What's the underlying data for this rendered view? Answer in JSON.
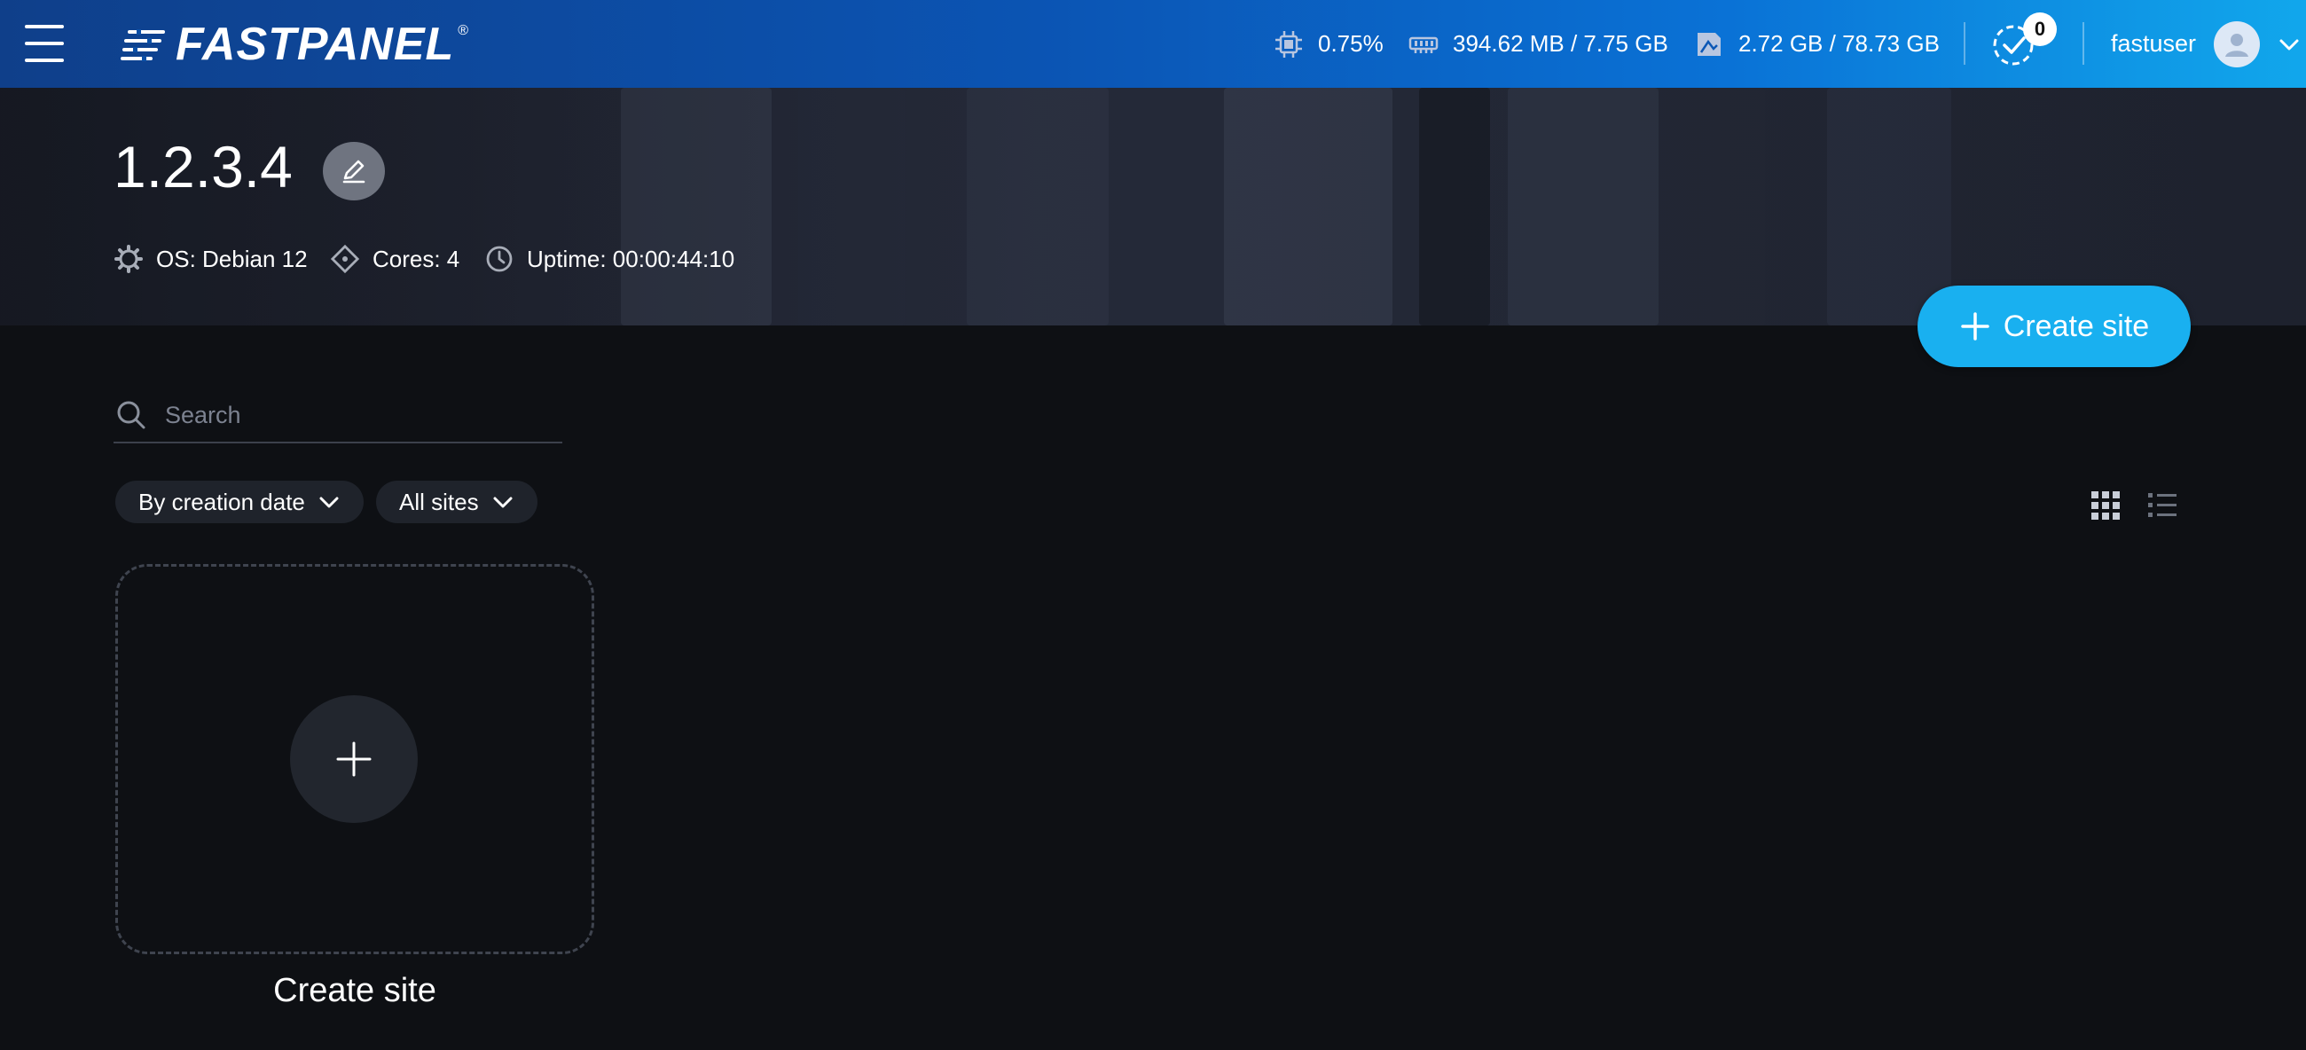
{
  "header": {
    "logo_text": "FASTPANEL",
    "logo_mark": "®",
    "menu_icon": "hamburger-menu-icon",
    "stats": {
      "cpu": {
        "icon": "cpu-icon",
        "value": "0.75%"
      },
      "memory": {
        "icon": "memory-icon",
        "value": "394.62 MB / 7.75 GB"
      },
      "disk": {
        "icon": "disk-icon",
        "value": "2.72 GB / 78.73 GB"
      }
    },
    "tasks": {
      "icon": "tasks-check-icon",
      "count": "0"
    },
    "user": {
      "name": "fastuser",
      "avatar_icon": "user-avatar-icon",
      "dropdown_icon": "chevron-down-icon"
    }
  },
  "server": {
    "title": "1.2.3.4",
    "edit_icon": "pencil-icon",
    "os": "OS: Debian 12",
    "cores": "Cores: 4",
    "uptime": "Uptime: 00:00:44:10"
  },
  "actions": {
    "create_site_label": "Create site"
  },
  "search": {
    "placeholder": "Search",
    "value": ""
  },
  "filters": {
    "sort": {
      "selected": "By creation date"
    },
    "scope": {
      "selected": "All sites"
    }
  },
  "view": {
    "grid_icon": "grid-view-icon",
    "list_icon": "list-view-icon",
    "active": "grid"
  },
  "sites": {
    "create_card_label": "Create site"
  },
  "colors": {
    "accent": "#19b0f0",
    "background": "#0e1014",
    "header_start": "#0f3f8a",
    "header_end": "#11a7ec"
  }
}
